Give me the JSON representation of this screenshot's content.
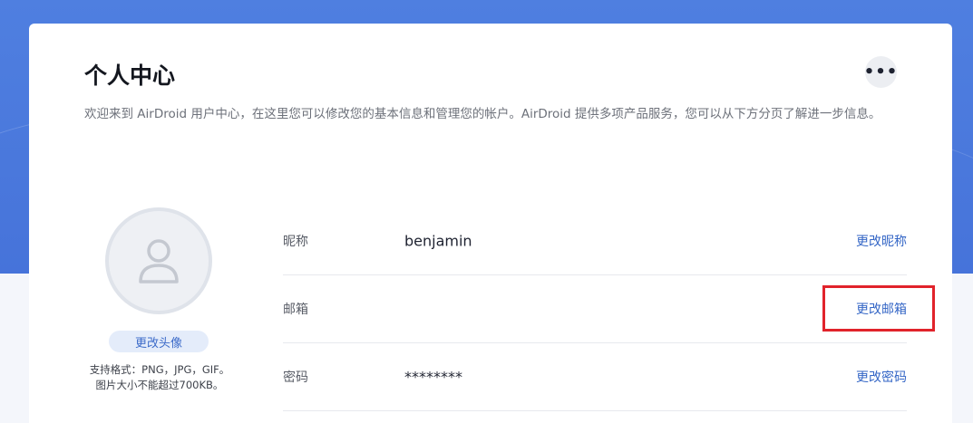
{
  "page": {
    "title": "个人中心",
    "intro": "欢迎来到 AirDroid 用户中心，在这里您可以修改您的基本信息和管理您的帐户。AirDroid 提供多项产品服务，您可以从下方分页了解进一步信息。",
    "more_icon": "more-horizontal-icon",
    "more_label": "•••"
  },
  "avatar": {
    "icon": "user-icon",
    "change_label": "更改头像",
    "hint_line1": "支持格式：PNG，JPG，GIF。",
    "hint_line2": "图片大小不能超过700KB。"
  },
  "profile_rows": [
    {
      "label": "昵称",
      "value": "benjamin",
      "action": "更改昵称"
    },
    {
      "label": "邮箱",
      "value": "",
      "action": "更改邮箱"
    },
    {
      "label": "密码",
      "value": "********",
      "action": "更改密码"
    }
  ],
  "colors": {
    "accent": "#3466c6",
    "header_bg": "#4a78dc",
    "highlight": "#e1232b"
  }
}
